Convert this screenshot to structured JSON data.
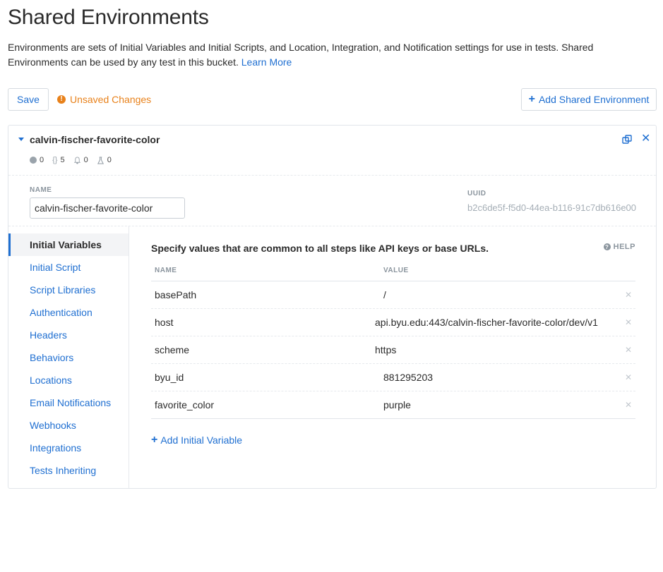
{
  "page": {
    "title": "Shared Environments",
    "intro": "Environments are sets of Initial Variables and Initial Scripts, and Location, Integration, and Notification settings for use in tests. Shared Environments can be used by any test in this bucket.",
    "learn_more": "Learn More"
  },
  "toolbar": {
    "save_label": "Save",
    "unsaved_label": "Unsaved Changes",
    "add_env_label": "Add Shared Environment"
  },
  "environment": {
    "name": "calvin-fischer-favorite-color",
    "stats": {
      "locations": "0",
      "scripts": "5",
      "notifications": "0",
      "tests": "0"
    },
    "name_label": "NAME",
    "name_value": "calvin-fischer-favorite-color",
    "uuid_label": "UUID",
    "uuid_value": "b2c6de5f-f5d0-44ea-b116-91c7db616e00"
  },
  "sidebar": {
    "items": [
      {
        "label": "Initial Variables",
        "active": true
      },
      {
        "label": "Initial Script"
      },
      {
        "label": "Script Libraries"
      },
      {
        "label": "Authentication"
      },
      {
        "label": "Headers"
      },
      {
        "label": "Behaviors"
      },
      {
        "label": "Locations"
      },
      {
        "label": "Email Notifications"
      },
      {
        "label": "Webhooks"
      },
      {
        "label": "Integrations"
      },
      {
        "label": "Tests Inheriting"
      }
    ]
  },
  "variables": {
    "description": "Specify values that are common to all steps like API keys or base URLs.",
    "help_label": "HELP",
    "col_name": "NAME",
    "col_value": "VALUE",
    "rows": [
      {
        "name": "basePath",
        "value": "/"
      },
      {
        "name": "host",
        "value": "api.byu.edu:443/calvin-fischer-favorite-color/dev/v1"
      },
      {
        "name": "scheme",
        "value": "https"
      },
      {
        "name": "byu_id",
        "value": "881295203"
      },
      {
        "name": "favorite_color",
        "value": "purple"
      }
    ],
    "add_label": "Add Initial Variable"
  },
  "colors": {
    "accent": "#1f6fd1",
    "warning": "#e8811a"
  },
  "icons": {
    "unsaved": "exclamation-circle-icon",
    "add": "plus-icon",
    "caret": "caret-down-icon",
    "copy": "copy-icon",
    "close": "close-icon",
    "delete_row": "x-icon",
    "help": "question-circle-icon"
  }
}
